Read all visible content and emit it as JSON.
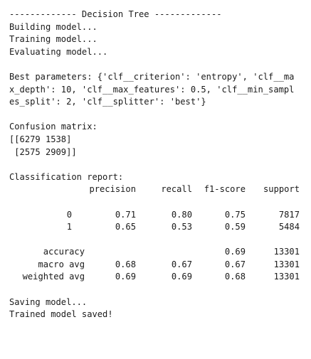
{
  "header": "------------- Decision Tree -------------",
  "progress": [
    "Building model...",
    "Training model...",
    "Evaluating model..."
  ],
  "best_params": {
    "lines": [
      "Best parameters: {'clf__criterion': 'entropy', 'clf__ma",
      "x_depth': 10, 'clf__max_features': 0.5, 'clf__min_sampl",
      "es_split': 2, 'clf__splitter': 'best'}"
    ]
  },
  "confusion": {
    "title": "Confusion matrix:",
    "rows": [
      "[[6279 1538]",
      " [2575 2909]]"
    ]
  },
  "report": {
    "title": "Classification report:",
    "headers": {
      "precision": "precision",
      "recall": "recall",
      "f1": "f1-score",
      "support": "support"
    },
    "class_rows": [
      {
        "label": "0",
        "precision": "0.71",
        "recall": "0.80",
        "f1": "0.75",
        "support": "7817"
      },
      {
        "label": "1",
        "precision": "0.65",
        "recall": "0.53",
        "f1": "0.59",
        "support": "5484"
      }
    ],
    "accuracy": {
      "label": "accuracy",
      "f1": "0.69",
      "support": "13301"
    },
    "macro": {
      "label": "macro avg",
      "precision": "0.68",
      "recall": "0.67",
      "f1": "0.67",
      "support": "13301"
    },
    "weighted": {
      "label": "weighted avg",
      "precision": "0.69",
      "recall": "0.69",
      "f1": "0.68",
      "support": "13301"
    }
  },
  "footer": [
    "Saving model...",
    "Trained model saved!"
  ]
}
